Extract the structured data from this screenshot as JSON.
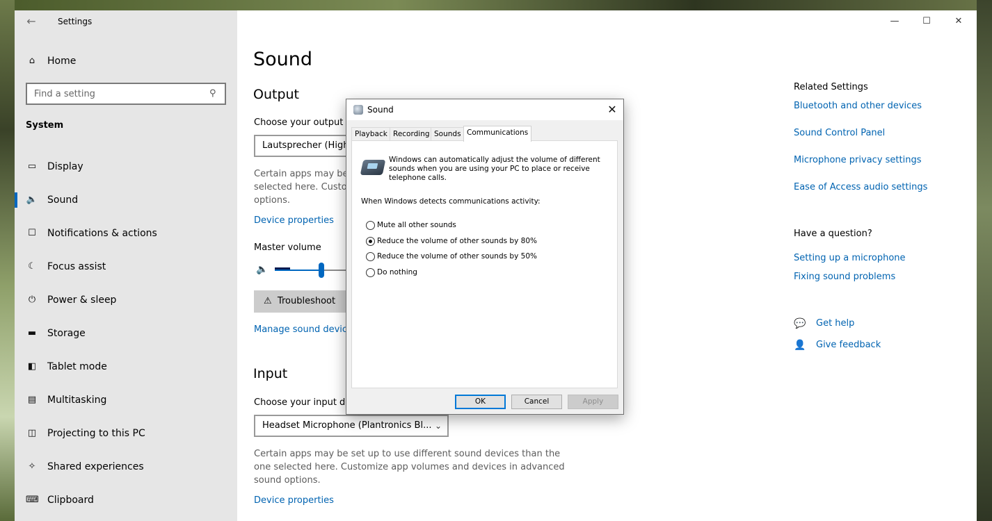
{
  "app": {
    "title": "Settings"
  },
  "sidebar": {
    "home_label": "Home",
    "search_placeholder": "Find a setting",
    "section_title": "System",
    "items": [
      {
        "label": "Display",
        "icon": "monitor-icon"
      },
      {
        "label": "Sound",
        "icon": "speaker-icon",
        "active": true
      },
      {
        "label": "Notifications & actions",
        "icon": "notifications-icon"
      },
      {
        "label": "Focus assist",
        "icon": "moon-icon"
      },
      {
        "label": "Power & sleep",
        "icon": "power-icon"
      },
      {
        "label": "Storage",
        "icon": "storage-icon"
      },
      {
        "label": "Tablet mode",
        "icon": "tablet-icon"
      },
      {
        "label": "Multitasking",
        "icon": "multitasking-icon"
      },
      {
        "label": "Projecting to this PC",
        "icon": "projecting-icon"
      },
      {
        "label": "Shared experiences",
        "icon": "shared-icon"
      },
      {
        "label": "Clipboard",
        "icon": "clipboard-icon"
      }
    ]
  },
  "main": {
    "page_title": "Sound",
    "output": {
      "heading": "Output",
      "choose_label": "Choose your output d",
      "device_value": "Lautsprecher (High",
      "desc_line1": "Certain apps may be s",
      "desc_line2": "selected here. Custom",
      "desc_line3": "options.",
      "device_properties": "Device properties",
      "master_volume": "Master volume",
      "master_volume_level_pct": 45,
      "troubleshoot": "Troubleshoot",
      "manage_devices": "Manage sound device"
    },
    "input": {
      "heading": "Input",
      "choose_label": "Choose your input de",
      "device_value": "Headset Microphone (Plantronics Bl...",
      "description": "Certain apps may be set up to use different sound devices than the one selected here. Customize app volumes and devices in advanced sound options.",
      "device_properties": "Device properties"
    },
    "related": {
      "heading": "Related Settings",
      "links": [
        "Bluetooth and other devices",
        "Sound Control Panel",
        "Microphone privacy settings",
        "Ease of Access audio settings"
      ],
      "question_heading": "Have a question?",
      "help_links": [
        "Setting up a microphone",
        "Fixing sound problems"
      ],
      "get_help": "Get help",
      "give_feedback": "Give feedback"
    }
  },
  "dialog": {
    "title": "Sound",
    "tabs": [
      "Playback",
      "Recording",
      "Sounds",
      "Communications"
    ],
    "active_tab": "Communications",
    "info_text": "Windows can automatically adjust the volume of different sounds when you are using your PC to place or receive telephone calls.",
    "detect_label": "When Windows detects communications activity:",
    "options": [
      {
        "label": "Mute all other sounds",
        "checked": false
      },
      {
        "label": "Reduce the volume of other sounds by 80%",
        "checked": true
      },
      {
        "label": "Reduce the volume of other sounds by 50%",
        "checked": false
      },
      {
        "label": "Do nothing",
        "checked": false
      }
    ],
    "buttons": {
      "ok": "OK",
      "cancel": "Cancel",
      "apply": "Apply"
    }
  }
}
